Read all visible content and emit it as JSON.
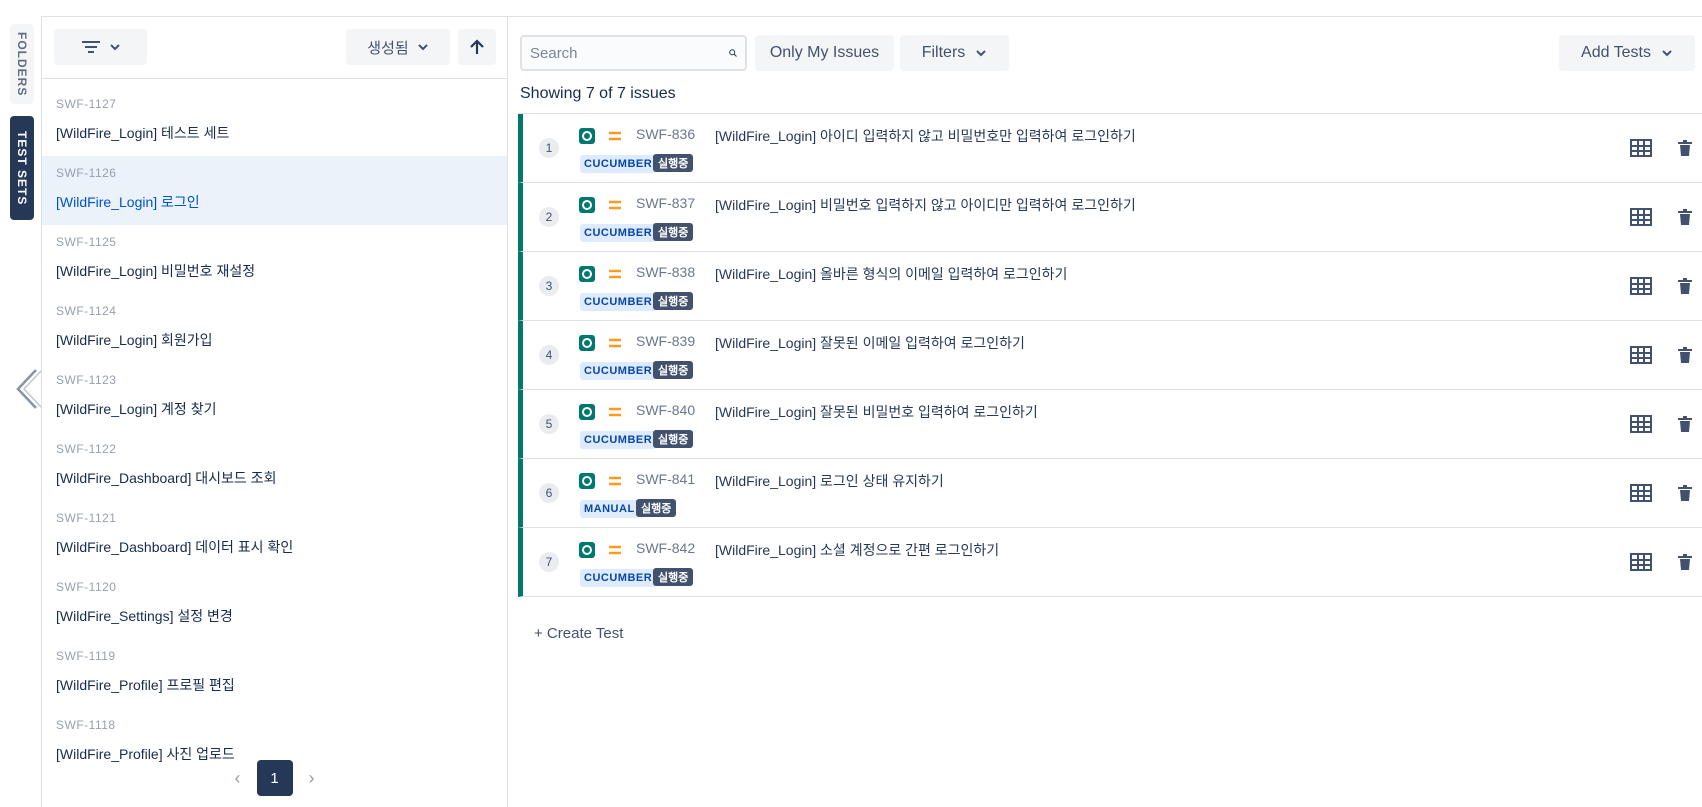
{
  "side_tabs": {
    "folders": "FOLDERS",
    "test_sets": "TEST SETS"
  },
  "left_panel": {
    "sort_label": "생성됨",
    "items": [
      {
        "key": "SWF-1127",
        "title": "[WildFire_Login] 테스트 세트",
        "selected": false
      },
      {
        "key": "SWF-1126",
        "title": "[WildFire_Login] 로그인",
        "selected": true
      },
      {
        "key": "SWF-1125",
        "title": "[WildFire_Login] 비밀번호 재설정",
        "selected": false
      },
      {
        "key": "SWF-1124",
        "title": "[WildFire_Login] 회원가입",
        "selected": false
      },
      {
        "key": "SWF-1123",
        "title": "[WildFire_Login] 계정 찾기",
        "selected": false
      },
      {
        "key": "SWF-1122",
        "title": "[WildFire_Dashboard] 대시보드 조회",
        "selected": false
      },
      {
        "key": "SWF-1121",
        "title": "[WildFire_Dashboard] 데이터 표시 확인",
        "selected": false
      },
      {
        "key": "SWF-1120",
        "title": "[WildFire_Settings] 설정 변경",
        "selected": false
      },
      {
        "key": "SWF-1119",
        "title": "[WildFire_Profile] 프로필 편집",
        "selected": false
      },
      {
        "key": "SWF-1118",
        "title": "[WildFire_Profile] 사진 업로드",
        "selected": false
      }
    ],
    "pagination": {
      "current_page": "1"
    }
  },
  "right_panel": {
    "search_placeholder": "Search",
    "only_my_issues": "Only My Issues",
    "filters": "Filters",
    "add_tests": "Add Tests",
    "showing": "Showing 7 of 7 issues",
    "create_test": "+ Create Test",
    "issues": [
      {
        "rank": "1",
        "key": "SWF-836",
        "summary": "[WildFire_Login] 아이디 입력하지 않고 비밀번호만 입력하여 로그인하기",
        "test_type": "CUCUMBER",
        "status": "실행중"
      },
      {
        "rank": "2",
        "key": "SWF-837",
        "summary": "[WildFire_Login] 비밀번호 입력하지 않고 아이디만 입력하여 로그인하기",
        "test_type": "CUCUMBER",
        "status": "실행중"
      },
      {
        "rank": "3",
        "key": "SWF-838",
        "summary": "[WildFire_Login] 올바른 형식의 이메일 입력하여 로그인하기",
        "test_type": "CUCUMBER",
        "status": "실행중"
      },
      {
        "rank": "4",
        "key": "SWF-839",
        "summary": "[WildFire_Login] 잘못된 이메일 입력하여 로그인하기",
        "test_type": "CUCUMBER",
        "status": "실행중"
      },
      {
        "rank": "5",
        "key": "SWF-840",
        "summary": "[WildFire_Login] 잘못된 비밀번호 입력하여 로그인하기",
        "test_type": "CUCUMBER",
        "status": "실행중"
      },
      {
        "rank": "6",
        "key": "SWF-841",
        "summary": "[WildFire_Login] 로그인 상태 유지하기",
        "test_type": "MANUAL",
        "status": "실행중"
      },
      {
        "rank": "7",
        "key": "SWF-842",
        "summary": "[WildFire_Login] 소셜 계정으로 간편 로그인하기",
        "test_type": "CUCUMBER",
        "status": "실행중"
      }
    ]
  },
  "colors": {
    "accent": "#00786f",
    "nav_dark": "#253858",
    "status": "#42526e",
    "priority": "#ff991f"
  },
  "icons": {
    "filter": "filter-icon",
    "chevron": "chevron-down-icon",
    "sort_direction": "arrow-up-icon",
    "search": "search-icon",
    "test_type": "test-type-icon",
    "priority": "priority-medium-icon",
    "table": "table-icon",
    "delete": "trash-icon",
    "collapse": "chevron-left-icon"
  }
}
